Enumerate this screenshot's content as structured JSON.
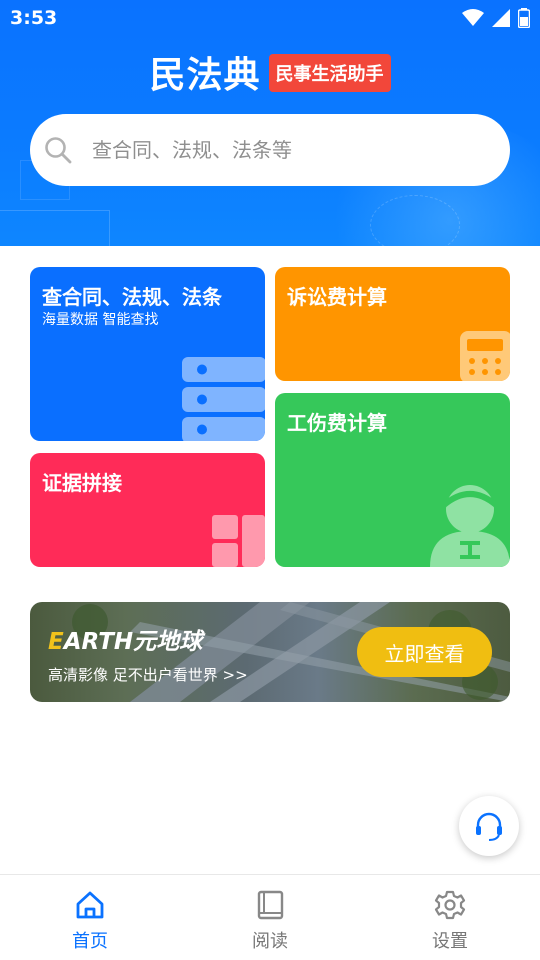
{
  "status_bar": {
    "time": "3:53"
  },
  "header": {
    "title": "民法典",
    "subtitle": "民事生活助手"
  },
  "search": {
    "placeholder": "查合同、法规、法条等"
  },
  "cards": {
    "lookup": {
      "title": "查合同、法规、法条",
      "subtitle": "海量数据 智能查找",
      "color": "#0a6fff"
    },
    "litigation_fee": {
      "title": "诉讼费计算",
      "color": "#ff9500"
    },
    "evidence": {
      "title": "证据拼接",
      "color": "#ff2b58"
    },
    "injury_fee": {
      "title": "工伤费计算",
      "color": "#36c85a"
    }
  },
  "banner": {
    "title_initial": "E",
    "title_rest": "ARTH元地球",
    "subtitle": "高清影像 足不出户看世界 >>",
    "button": "立即查看",
    "button_color": "#f0be11"
  },
  "fab": {
    "icon": "headset-icon"
  },
  "tabbar": {
    "items": [
      {
        "label": "首页",
        "icon": "home-icon",
        "active": true
      },
      {
        "label": "阅读",
        "icon": "book-icon",
        "active": false
      },
      {
        "label": "设置",
        "icon": "gear-icon",
        "active": false
      }
    ],
    "active_color": "#0a72ff"
  }
}
